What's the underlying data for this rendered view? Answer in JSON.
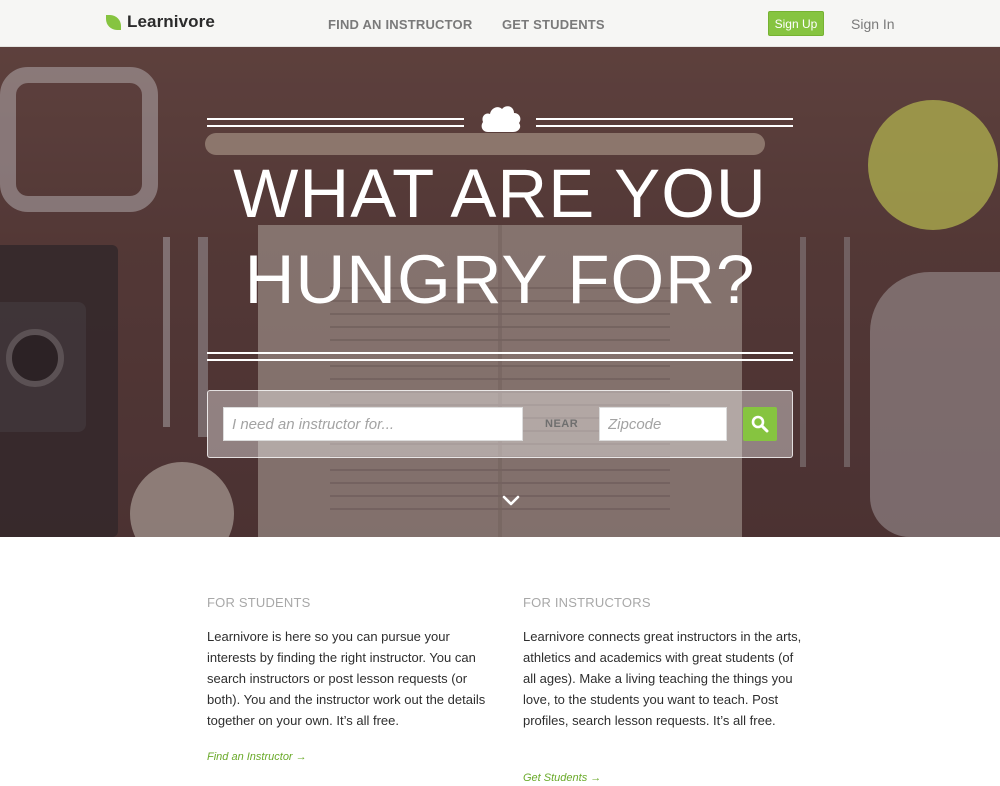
{
  "brand": {
    "name": "Learnivore",
    "accent_color": "#86c440"
  },
  "nav": {
    "find_instructor": "FIND AN INSTRUCTOR",
    "get_students": "GET STUDENTS",
    "sign_up": "Sign Up",
    "sign_in": "Sign In"
  },
  "hero": {
    "headline_line1": "WHAT ARE YOU",
    "headline_line2": "HUNGRY FOR?",
    "search": {
      "instructor_placeholder": "I need an instructor for...",
      "near_label": "NEAR",
      "zip_placeholder": "Zipcode",
      "button_icon": "search-icon"
    },
    "scroll_icon": "chevron-down-icon",
    "cloud_icon": "cloud-icon"
  },
  "students": {
    "heading": "FOR STUDENTS",
    "body": "Learnivore is here so you can pursue your interests by finding the right instructor. You can search instructors or post lesson requests (or both). You and the instructor work out the details together on your own. It’s all free.",
    "link": "Find an Instructor →"
  },
  "instructors": {
    "heading": "FOR INSTRUCTORS",
    "body": "Learnivore connects great instructors in the arts, athletics and academics with great students (of all ages). Make a living teaching the things you love, to the students you want to teach. Post profiles, search lesson requests. It’s all free.",
    "link": "Get Students →"
  }
}
